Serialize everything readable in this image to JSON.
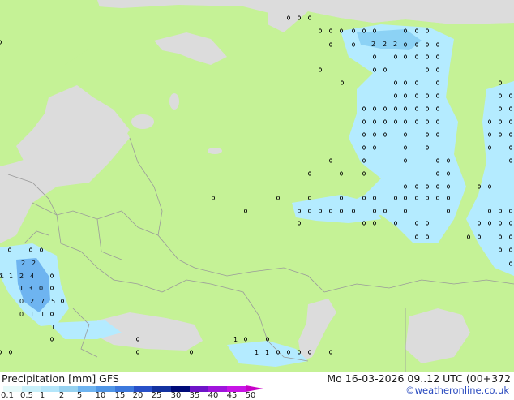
{
  "map": {
    "colors": {
      "sea": "#dcdcdc",
      "land_base": "#c5f296",
      "light_precip": "#b4ebff",
      "moderate_precip": "#8cd2f5",
      "borders": "#9a9a9a",
      "marker": "#000000"
    }
  },
  "footer": {
    "title_left": "Precipitation [mm]  GFS",
    "title_right": "Mo 16-03-2026 09..12 UTC (00+372",
    "credit": "©weatheronline.co.uk",
    "colorbar_colors": [
      "#e6fafa",
      "#c8f0fa",
      "#b4e6fa",
      "#96d2f0",
      "#6eb4f0",
      "#5096e6",
      "#3c78dc",
      "#2850c8",
      "#1432a0",
      "#000a78",
      "#6e14c8",
      "#a014dc",
      "#c814e6",
      "#e614c8",
      "#f014a0"
    ],
    "colorbar_labels": [
      "0.1",
      "0.5",
      "1",
      "2",
      "5",
      "10",
      "15",
      "20",
      "25",
      "30",
      "35",
      "40",
      "45",
      "50"
    ]
  }
}
